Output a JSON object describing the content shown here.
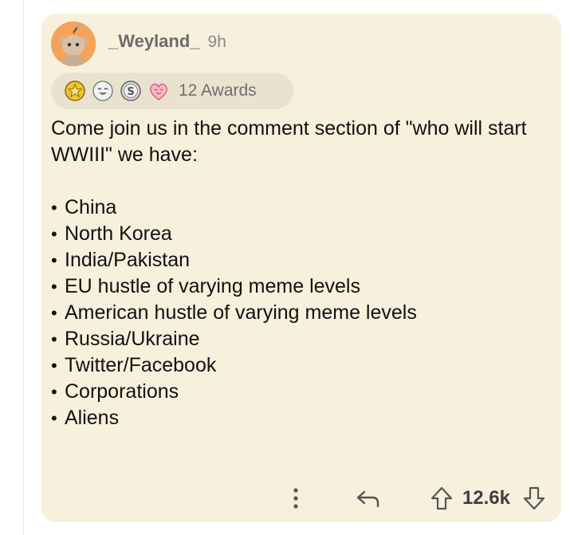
{
  "comment": {
    "username": "_Weyland_",
    "time": "9h",
    "avatar_icon": "reddit-snoo-avatar",
    "awards": {
      "icons": [
        "gold-star-award-icon",
        "laughing-face-award-icon",
        "silver-coin-award-icon",
        "heart-face-award-icon"
      ],
      "label": "12 Awards"
    },
    "body": {
      "intro": "Come join us in the comment section of \"who will start WWIII\" we have:",
      "bullets": [
        "China",
        "North Korea",
        "India/Pakistan",
        "EU hustle of varying meme levels",
        "American hustle of varying meme levels",
        "Russia/Ukraine",
        "Twitter/Facebook",
        "Corporations",
        "Aliens"
      ]
    },
    "actions": {
      "more_icon": "vertical-dots-icon",
      "reply_icon": "reply-arrow-icon",
      "upvote_icon": "upvote-arrow-icon",
      "score": "12.6k",
      "downvote_icon": "downvote-arrow-icon"
    }
  },
  "colors": {
    "card_background": "#f7f0dc",
    "avatar_background": "#f5a25b",
    "awards_pill": "#e9e2cf"
  }
}
